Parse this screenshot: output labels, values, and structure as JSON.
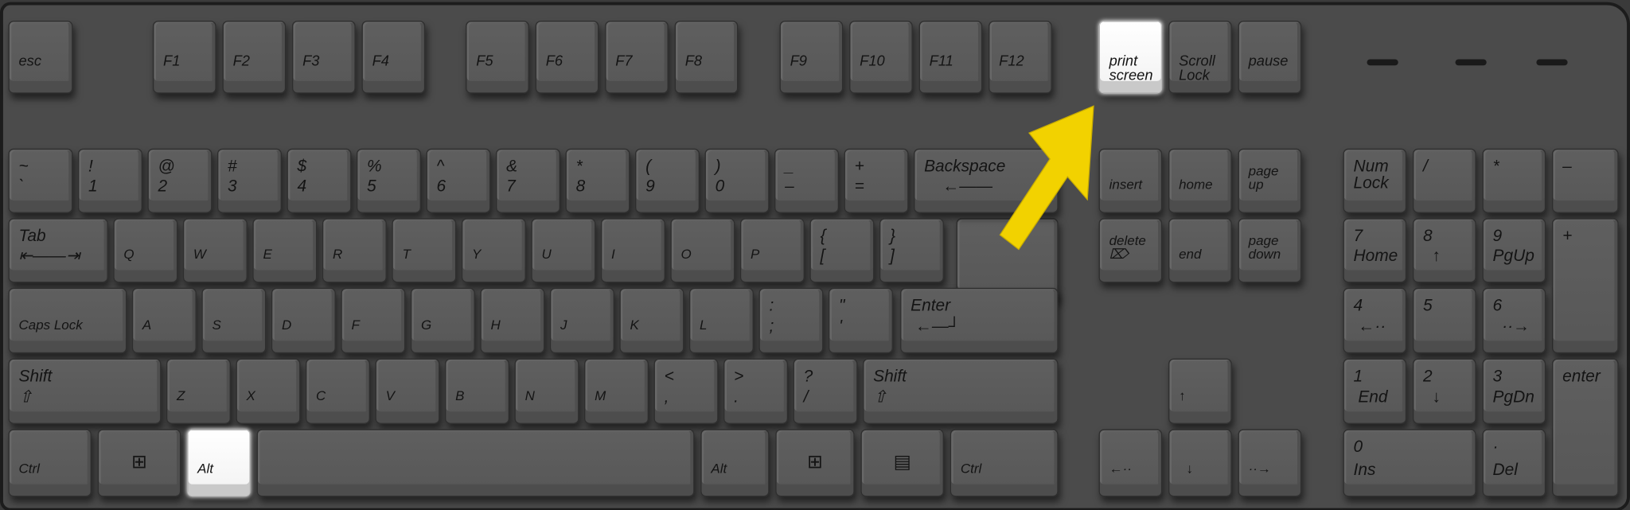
{
  "keys": [
    {
      "mid": "esc"
    },
    {
      "mid": "F1"
    },
    {
      "mid": "F2"
    },
    {
      "mid": "F3"
    },
    {
      "mid": "F4"
    },
    {
      "mid": "F5"
    },
    {
      "mid": "F6"
    },
    {
      "mid": "F7"
    },
    {
      "mid": "F8"
    },
    {
      "mid": "F9"
    },
    {
      "mid": "F10"
    },
    {
      "mid": "F11"
    },
    {
      "mid": "F12"
    },
    {
      "mid": "print\nscreen",
      "highlight": true
    },
    {
      "mid": "Scroll\nLock"
    },
    {
      "mid": "pause"
    },
    {
      "top": "~",
      "bottom": "`"
    },
    {
      "top": "!",
      "bottom": "1"
    },
    {
      "top": "@",
      "bottom": "2"
    },
    {
      "top": "#",
      "bottom": "3"
    },
    {
      "top": "$",
      "bottom": "4"
    },
    {
      "top": "%",
      "bottom": "5"
    },
    {
      "top": "^",
      "bottom": "6"
    },
    {
      "top": "&",
      "bottom": "7"
    },
    {
      "top": "*",
      "bottom": "8"
    },
    {
      "top": "(",
      "bottom": "9"
    },
    {
      "top": ")",
      "bottom": "0"
    },
    {
      "top": "_",
      "bottom": "–"
    },
    {
      "top": "+",
      "bottom": "="
    },
    {
      "top": "Backspace",
      "bottom": "    ←——"
    },
    {
      "label": "insert"
    },
    {
      "label": "home"
    },
    {
      "label": "page\nup"
    },
    {
      "top": "Num\nLock"
    },
    {
      "top": "/"
    },
    {
      "top": "*"
    },
    {
      "top": "–"
    },
    {
      "top": "Tab",
      "bottom": "⇤——⇥"
    },
    {
      "label": "Q"
    },
    {
      "label": "W"
    },
    {
      "label": "E"
    },
    {
      "label": "R"
    },
    {
      "label": "T"
    },
    {
      "label": "Y"
    },
    {
      "label": "U"
    },
    {
      "label": "I"
    },
    {
      "label": "O"
    },
    {
      "label": "P"
    },
    {
      "top": "{",
      "bottom": "["
    },
    {
      "top": "}",
      "bottom": "]"
    },
    {
      "label": "delete\n⌦"
    },
    {
      "label": "end"
    },
    {
      "label": "page\ndown"
    },
    {
      "top": "7",
      "bottom": "Home"
    },
    {
      "top": "8",
      "bottom": "  ↑"
    },
    {
      "top": "9",
      "bottom": "PgUp"
    },
    {
      "top": "+"
    },
    {
      "label": "Caps Lock"
    },
    {
      "label": "A"
    },
    {
      "label": "S"
    },
    {
      "label": "D"
    },
    {
      "label": "F"
    },
    {
      "label": "G"
    },
    {
      "label": "H"
    },
    {
      "label": "J"
    },
    {
      "label": "K"
    },
    {
      "label": "L"
    },
    {
      "top": ":",
      "bottom": ";"
    },
    {
      "top": "\"",
      "bottom": "'"
    },
    {
      "top": "Enter",
      "bottom": " ←—┘"
    },
    {
      "top": "4",
      "bottom": " ←··"
    },
    {
      "top": "5"
    },
    {
      "top": "6",
      "bottom": "  ··→"
    },
    {
      "top": "Shift",
      "bottom": "⇧"
    },
    {
      "label": "Z"
    },
    {
      "label": "X"
    },
    {
      "label": "C"
    },
    {
      "label": "V"
    },
    {
      "label": "B"
    },
    {
      "label": "N"
    },
    {
      "label": "M"
    },
    {
      "top": "<",
      "bottom": ","
    },
    {
      "top": ">",
      "bottom": "."
    },
    {
      "top": "?",
      "bottom": "/"
    },
    {
      "top": "Shift",
      "bottom": "⇧"
    },
    {
      "label": "↑"
    },
    {
      "top": "1",
      "bottom": " End"
    },
    {
      "top": "2",
      "bottom": "  ↓"
    },
    {
      "top": "3",
      "bottom": "PgDn"
    },
    {
      "top": "enter"
    },
    {
      "label": "Ctrl"
    },
    {
      "icon": "⊞",
      "icon_name": "windows-logo-icon"
    },
    {
      "label": "Alt",
      "highlight": true
    },
    {},
    {
      "label": "Alt"
    },
    {
      "icon": "⊞",
      "icon_name": "windows-logo-icon"
    },
    {
      "icon": "▤",
      "icon_name": "menu-icon"
    },
    {
      "label": "Ctrl"
    },
    {
      "label": "←··"
    },
    {
      "label": "  ↓"
    },
    {
      "label": "··→"
    },
    {
      "top": "0",
      "bottom": "Ins"
    },
    {
      "top": "·",
      "bottom": "Del"
    }
  ],
  "highlight_color": "#ffffff",
  "arrow_color": "#f2d200",
  "arrow_points_to": "print screen"
}
